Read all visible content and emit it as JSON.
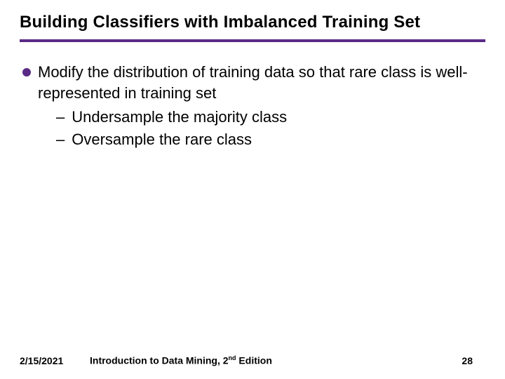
{
  "title": "Building Classifiers with Imbalanced Training Set",
  "bullet_main": "Modify the distribution of training data so that rare class is well-represented in training set",
  "sub_items": {
    "a": "Undersample the majority class",
    "b": "Oversample the rare class"
  },
  "footer": {
    "date": "2/15/2021",
    "book_prefix": "Introduction to Data Mining, 2",
    "book_ord": "nd",
    "book_suffix": " Edition",
    "page": "28"
  },
  "accent_color": "#5b2a86"
}
